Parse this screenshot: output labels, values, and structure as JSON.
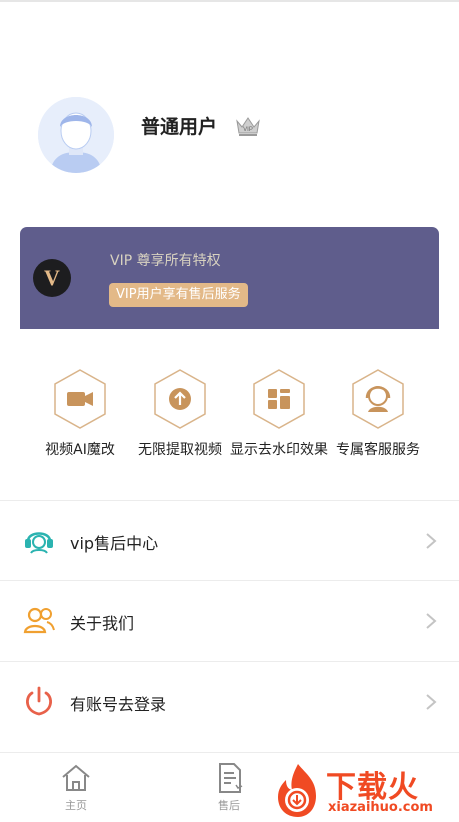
{
  "profile": {
    "username": "普通用户",
    "badge_icon": "vip-crown-icon"
  },
  "vip_card": {
    "logo_letter": "V",
    "title": "VIP 尊享所有特权",
    "badge": "VIP用户享有售后服务"
  },
  "features": [
    {
      "label": "视频AI魔改",
      "icon": "video-camera-icon"
    },
    {
      "label": "无限提取视频",
      "icon": "upload-arrow-icon"
    },
    {
      "label": "显示去水印效果",
      "icon": "grid-apps-icon"
    },
    {
      "label": "专属客服服务",
      "icon": "customer-service-icon"
    }
  ],
  "menu": [
    {
      "label": "vip售后中心",
      "icon": "headset-icon"
    },
    {
      "label": "关于我们",
      "icon": "users-icon"
    },
    {
      "label": "有账号去登录",
      "icon": "power-icon"
    }
  ],
  "tabs": [
    {
      "label": "主页",
      "icon": "home-icon"
    },
    {
      "label": "售后",
      "icon": "document-icon"
    }
  ],
  "watermark": {
    "title": "下载火",
    "url": "xiazaihuo.com"
  },
  "colors": {
    "vip_card_bg": "#5f5d8c",
    "vip_badge_bg": "#e3b988",
    "accent_gold": "#c8945c",
    "menu_icon_teal": "#2bb3b0",
    "menu_icon_orange": "#f0a030",
    "menu_icon_red": "#e8614a",
    "watermark_red": "#f04a23"
  }
}
